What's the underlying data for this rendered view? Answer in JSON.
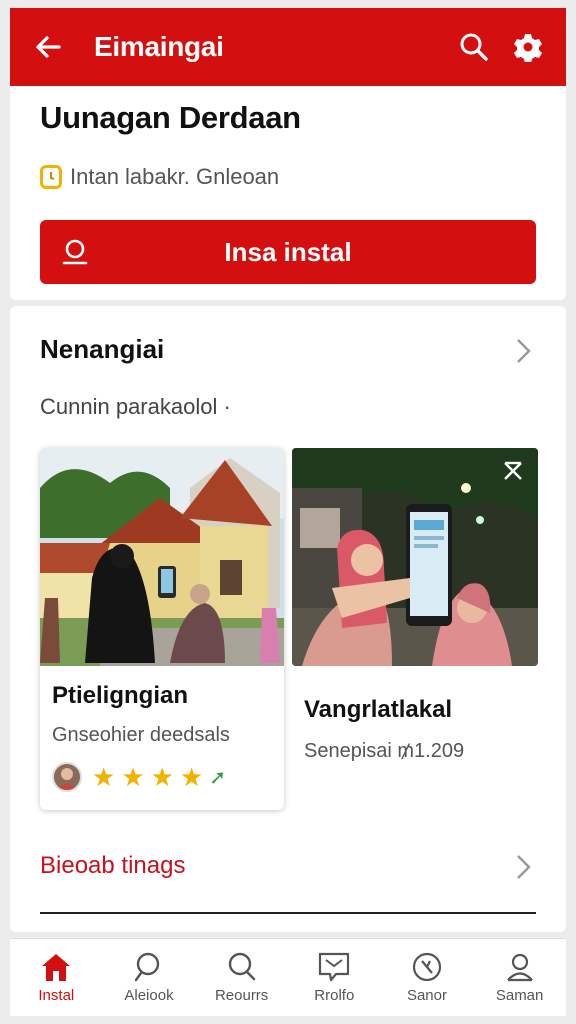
{
  "colors": {
    "primary": "#d40f0f",
    "link": "#c8101e",
    "star": "#f2b300"
  },
  "appbar": {
    "title": "Eimaingai",
    "back_icon": "arrow-left-icon",
    "search_icon": "search-icon",
    "settings_icon": "gear-icon"
  },
  "header_card": {
    "heading": "Uunagan Derdaan",
    "status_text": "Intan labakr. Gnleoan",
    "install_label": "Insa instal"
  },
  "section": {
    "heading": "Nenangiai",
    "subheading": "Cunnin parakaolol ·",
    "cards": [
      {
        "title": "Ptieligngian",
        "subtitle": "Gnseohier deedsals",
        "rating": 4
      },
      {
        "title": "Vangrlatlakal",
        "subtitle": "Senepisai ₥1.209"
      }
    ],
    "footer_link": "Bieoab tinags"
  },
  "bottom_nav": [
    {
      "label": "Instal",
      "icon": "home-icon",
      "active": true
    },
    {
      "label": "Aleiook",
      "icon": "search-icon",
      "active": false
    },
    {
      "label": "Reourrs",
      "icon": "search-icon",
      "active": false
    },
    {
      "label": "Rrolfo",
      "icon": "message-icon",
      "active": false
    },
    {
      "label": "Sanor",
      "icon": "compass-icon",
      "active": false
    },
    {
      "label": "Saman",
      "icon": "person-icon",
      "active": false
    }
  ]
}
